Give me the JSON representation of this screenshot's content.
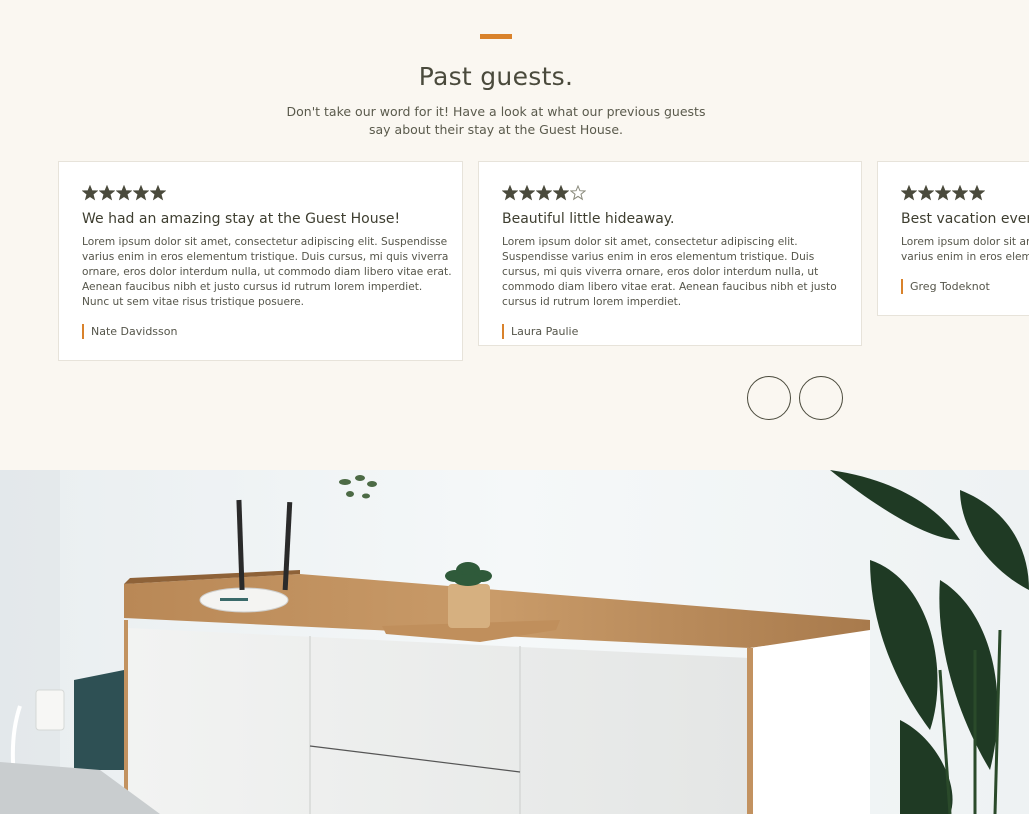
{
  "testimonials": {
    "title": "Past guests.",
    "subtitle": "Don't take our word for it! Have a look at what our previous guests say about their stay at the Guest House.",
    "accent_color": "#d9822b",
    "reviews": [
      {
        "rating": 5,
        "title": "We had an amazing stay at the Guest House!",
        "body": "Lorem ipsum dolor sit amet, consectetur adipiscing elit. Suspendisse varius enim in eros elementum tristique. Duis cursus, mi quis viverra ornare, eros dolor interdum nulla, ut commodo diam libero vitae erat. Aenean faucibus nibh et justo cursus id rutrum lorem imperdiet. Nunc ut sem vitae risus tristique posuere.",
        "author": "Nate Davidsson"
      },
      {
        "rating": 4,
        "title": "Beautiful little hideaway.",
        "body": "Lorem ipsum dolor sit amet, consectetur adipiscing elit. Suspendisse varius enim in eros elementum tristique. Duis cursus, mi quis viverra ornare, eros dolor interdum nulla, ut commodo diam libero vitae erat. Aenean faucibus nibh et justo cursus id rutrum lorem imperdiet.",
        "author": "Laura Paulie"
      },
      {
        "rating": 5,
        "title": "Best vacation ever!",
        "body_line1": "Lorem ipsum dolor sit amet",
        "body_line2": "varius enim in eros element",
        "author": "Greg Todeknot"
      }
    ],
    "slider": {
      "prev_icon": "circle-arrow-left-icon",
      "next_icon": "circle-arrow-right-icon"
    }
  },
  "hero_image": {
    "subject": "wooden sideboard with router and potted succulent, tropical plant leaves"
  }
}
